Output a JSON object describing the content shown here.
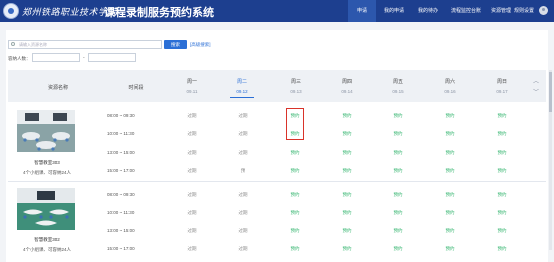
{
  "header": {
    "school_name": "郑州铁路职业技术学院",
    "app_title": "课程录制服务预约系统",
    "nav": [
      {
        "label": "申请",
        "active": true
      },
      {
        "label": "我的申请",
        "active": false
      },
      {
        "label": "我的待办",
        "active": false
      },
      {
        "label": "流程监控台账",
        "active": false
      },
      {
        "label": "资源管理",
        "active": false
      },
      {
        "label": "规则设置",
        "active": false
      }
    ]
  },
  "filters": {
    "search_placeholder": "请输入资源名称",
    "search_button": "搜索",
    "advanced_link": "[高级搜索]",
    "capacity_label": "容纳人数：",
    "capacity_min": "",
    "capacity_max": "",
    "dash": "-"
  },
  "table": {
    "col_resource": "资源名称",
    "col_time": "时间段",
    "days": [
      {
        "name": "周一",
        "date": "09.11",
        "selected": false
      },
      {
        "name": "周二",
        "date": "09.12",
        "selected": true
      },
      {
        "name": "周三",
        "date": "09.13",
        "selected": false
      },
      {
        "name": "周四",
        "date": "09.14",
        "selected": false
      },
      {
        "name": "周五",
        "date": "09.15",
        "selected": false
      },
      {
        "name": "周六",
        "date": "09.16",
        "selected": false
      },
      {
        "name": "周日",
        "date": "09.17",
        "selected": false
      }
    ],
    "arrow_up": "︿",
    "arrow_down": "﹀"
  },
  "rooms": [
    {
      "name": "智慧教室303",
      "desc": "4个小组课、可容纳24人",
      "slots": [
        {
          "time": "08:00 ~ 09:30",
          "cells": [
            "过期",
            "过期",
            "预约",
            "预约",
            "预约",
            "预约",
            "预约"
          ]
        },
        {
          "time": "10:00 ~ 11:30",
          "cells": [
            "过期",
            "过期",
            "预约",
            "预约",
            "预约",
            "预约",
            "预约"
          ]
        },
        {
          "time": "13:00 ~ 15:00",
          "cells": [
            "过期",
            "过期",
            "预约",
            "预约",
            "预约",
            "预约",
            "预约"
          ]
        },
        {
          "time": "15:00 ~ 17:00",
          "cells": [
            "过期",
            "预",
            "预约",
            "预约",
            "预约",
            "预约",
            "预约"
          ]
        }
      ]
    },
    {
      "name": "智慧教室302",
      "desc": "4个小组课、可容纳24人",
      "slots": [
        {
          "time": "08:00 ~ 09:30",
          "cells": [
            "过期",
            "过期",
            "预约",
            "预约",
            "预约",
            "预约",
            "预约"
          ]
        },
        {
          "time": "10:00 ~ 11:30",
          "cells": [
            "过期",
            "过期",
            "预约",
            "预约",
            "预约",
            "预约",
            "预约"
          ]
        },
        {
          "time": "13:00 ~ 15:00",
          "cells": [
            "过期",
            "过期",
            "预约",
            "预约",
            "预约",
            "预约",
            "预约"
          ]
        },
        {
          "time": "15:00 ~ 17:00",
          "cells": [
            "过期",
            "过期",
            "预约",
            "预约",
            "预约",
            "预约",
            "预约"
          ]
        }
      ]
    }
  ],
  "colors": {
    "header_bg": "#1d3f8f",
    "accent": "#2b6fd6",
    "available": "#2fb36b",
    "expired": "#888888",
    "highlight": "#d9332a"
  }
}
